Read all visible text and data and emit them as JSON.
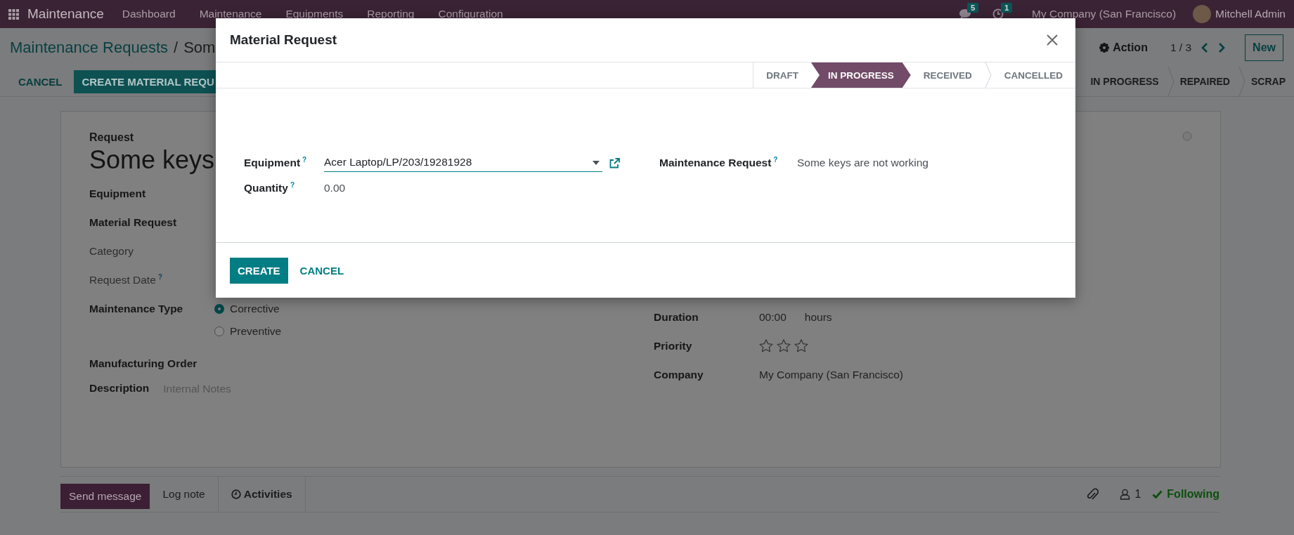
{
  "navbar": {
    "app_name": "Maintenance",
    "menu": [
      "Dashboard",
      "Maintenance",
      "Equipments",
      "Reporting",
      "Configuration"
    ],
    "messages_count": "5",
    "activities_count": "1",
    "company": "My Company (San Francisco)",
    "user": "Mitchell Admin"
  },
  "control_panel": {
    "breadcrumb": [
      "Maintenance Requests",
      "Som"
    ],
    "breadcrumb_separator": "/",
    "action": "Action",
    "pager": "1 / 3",
    "new_button": "New"
  },
  "form_buttons": [
    {
      "label": "CANCEL",
      "kind": "secondary"
    },
    {
      "label": "CREATE MATERIAL REQU",
      "kind": "primary"
    }
  ],
  "statusbar": [
    {
      "label": "IN PROGRESS",
      "selected": false
    },
    {
      "label": "REPAIRED",
      "selected": false
    },
    {
      "label": "SCRAP",
      "selected": false
    }
  ],
  "form": {
    "title_label": "Request",
    "title": "Some keys",
    "left_fields": [
      {
        "label": "Equipment",
        "muted": false
      },
      {
        "label": "Material Request",
        "muted": false
      },
      {
        "label": "Category",
        "muted": true
      },
      {
        "label": "Request Date",
        "help": "?",
        "muted": true
      }
    ],
    "maintenance_type": {
      "label": "Maintenance Type",
      "options": [
        {
          "label": "Corrective",
          "selected": true
        },
        {
          "label": "Preventive",
          "selected": false
        }
      ]
    },
    "manufacturing_order": {
      "label": "Manufacturing Order"
    },
    "description": {
      "label": "Description",
      "placeholder": "Internal Notes"
    },
    "duration": {
      "label": "Duration",
      "value": "00:00",
      "unit": "hours"
    },
    "priority": {
      "label": "Priority",
      "stars": 0
    },
    "company": {
      "label": "Company",
      "value": "My Company (San Francisco)"
    }
  },
  "chatter": {
    "composer_tabs": [
      {
        "label": "Send message",
        "selected": true
      },
      {
        "label": "Log note",
        "selected": false
      }
    ],
    "activities": "Activities",
    "followers_count": "1",
    "following": "Following"
  },
  "modal": {
    "title": "Material Request",
    "statusbar": [
      {
        "label": "DRAFT",
        "selected": false
      },
      {
        "label": "IN PROGRESS",
        "selected": true
      },
      {
        "label": "RECEIVED",
        "selected": false
      },
      {
        "label": "CANCELLED",
        "selected": false
      }
    ],
    "left_fields": [
      {
        "label": "Equipment",
        "help": "?",
        "value": "Acer Laptop/LP/203/19281928",
        "kind": "many2one"
      },
      {
        "label": "Quantity",
        "help": "?",
        "value": "0.00",
        "kind": "text"
      }
    ],
    "right_fields": [
      {
        "label": "Maintenance Request",
        "help": "?",
        "value": "Some keys are not working",
        "kind": "text"
      }
    ],
    "buttons": [
      {
        "label": "CREATE",
        "kind": "primary"
      },
      {
        "label": "CANCEL",
        "kind": "secondary"
      }
    ]
  }
}
